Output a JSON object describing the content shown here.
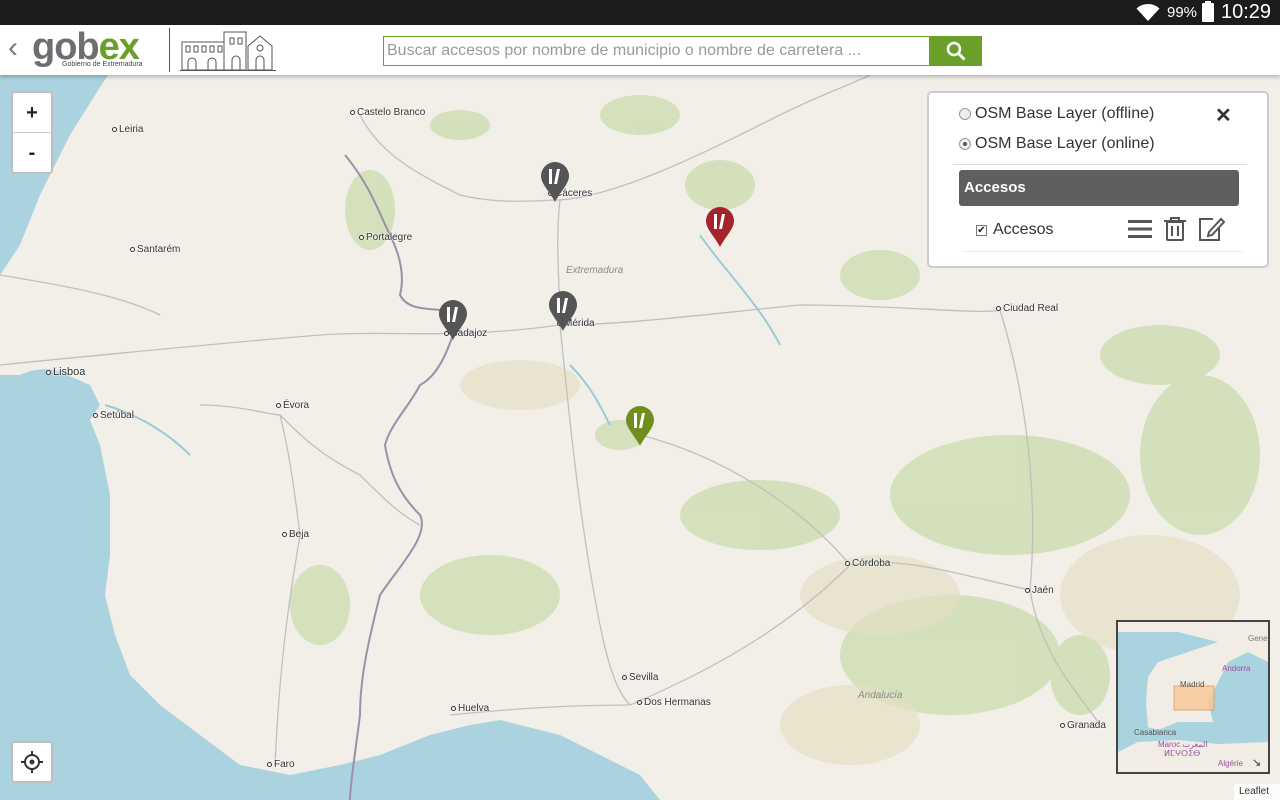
{
  "status_bar": {
    "battery": "99%",
    "time": "10:29"
  },
  "header": {
    "logo_prefix": "gob",
    "logo_suffix": "ex",
    "logo_subtitle": "Gobierno de Extremadura",
    "search_placeholder": "Buscar accesos por nombre de municipio o nombre de carretera ..."
  },
  "map": {
    "zoom_in": "+",
    "zoom_out": "-",
    "places": [
      "Castelo Branco",
      "Leiria",
      "Cáceres",
      "Portalegre",
      "Santarém",
      "Badajoz",
      "Mérida",
      "Lisboa",
      "Setúbal",
      "Évora",
      "Ciudad Real",
      "Beja",
      "Córdoba",
      "Jaén",
      "Sevilla",
      "Dos Hermanas",
      "Huelva",
      "Granada",
      "Faro"
    ],
    "regions": [
      "Extremadura",
      "Andalucía"
    ],
    "markers": [
      {
        "name": "Cáceres",
        "color": "#555555"
      },
      {
        "name": "Badajoz",
        "color": "#555555"
      },
      {
        "name": "Mérida",
        "color": "#555555"
      },
      {
        "name": "Acceso rojo",
        "color": "#a5232a"
      },
      {
        "name": "Acceso verde",
        "color": "#6f8e1d"
      }
    ],
    "attribution": "Leaflet"
  },
  "layers_panel": {
    "base_layers": [
      {
        "label": "OSM Base Layer (offline)",
        "checked": false
      },
      {
        "label": "OSM Base Layer (online)",
        "checked": true
      }
    ],
    "group_title": "Accesos",
    "overlay": {
      "label": "Accesos",
      "checked": true
    }
  },
  "minimap": {
    "labels": [
      "Gene",
      "Andorra",
      "Madrid",
      "Casablanca",
      "Maroc المغرب",
      "ⵍⵎⵖⵔⵉⴱ",
      "Algérie"
    ]
  }
}
